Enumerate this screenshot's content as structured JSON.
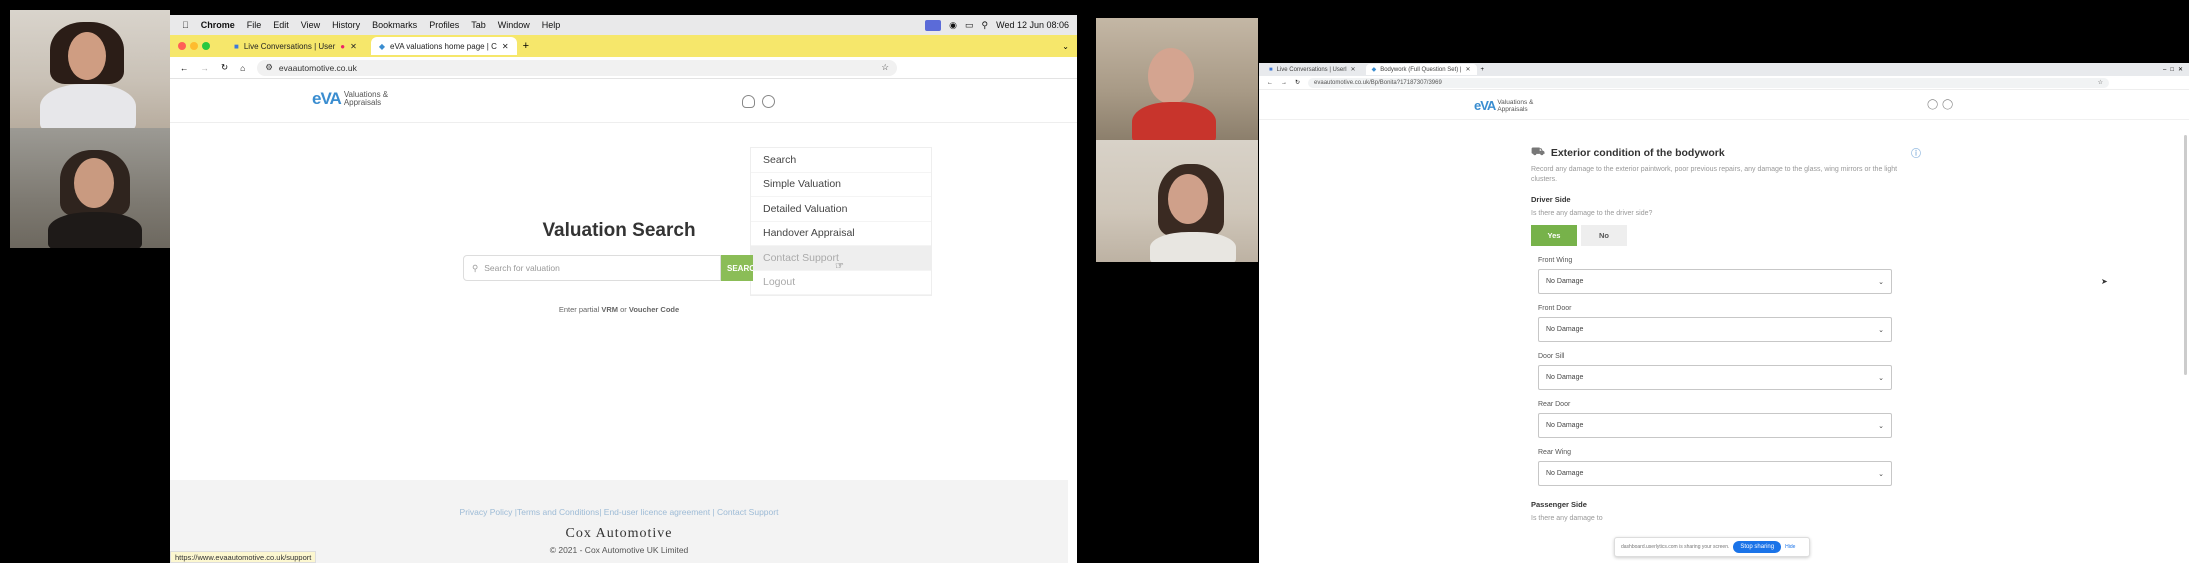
{
  "mac": {
    "menubar": {
      "apple": "",
      "app": "Chrome",
      "items": [
        "File",
        "Edit",
        "View",
        "History",
        "Bookmarks",
        "Profiles",
        "Tab",
        "Window",
        "Help"
      ],
      "clock": "Wed 12 Jun  08:06"
    },
    "tabs": [
      {
        "label": "Live Conversations | User"
      },
      {
        "label": "eVA valuations home page | C"
      }
    ],
    "url": "evaautomotive.co.uk",
    "logo": {
      "eva": "eVA",
      "line1": "Valuations &",
      "line2": "Appraisals"
    },
    "menu": {
      "items": [
        "Search",
        "Simple Valuation",
        "Detailed Valuation",
        "Handover Appraisal",
        "Contact Support",
        "Logout"
      ]
    },
    "title": "Valuation Search",
    "search": {
      "placeholder": "Search for valuation",
      "button": "SEARCH"
    },
    "hint": {
      "prefix": "Enter partial ",
      "vrm": "VRM",
      "or": " or ",
      "voucher": "Voucher Code"
    },
    "footer": {
      "links": "Privacy Policy  |Terms and Conditions| End-user licence agreement  |  Contact Support",
      "brand": "Cox Automotive",
      "copyright": "© 2021 - Cox Automotive UK Limited"
    },
    "status_url": "https://www.evaautomotive.co.uk/support"
  },
  "win": {
    "tabs": [
      {
        "label": "Live Conversations | Userl"
      },
      {
        "label": "Bodywork (Full Question Set) |"
      }
    ],
    "url": "evaautomotive.co.uk/Bp/Bonita?17187307/3969",
    "logo": {
      "eva": "eVA",
      "line1": "Valuations &",
      "line2": "Appraisals"
    },
    "section": {
      "title": "Exterior condition of the bodywork",
      "description": "Record any damage to the exterior paintwork, poor previous repairs, any damage to the glass, wing mirrors or the light clusters."
    },
    "driver": {
      "title": "Driver Side",
      "question": "Is there any damage to the driver side?",
      "yes": "Yes",
      "no": "No"
    },
    "fields": [
      {
        "label": "Front Wing",
        "value": "No Damage"
      },
      {
        "label": "Front Door",
        "value": "No Damage"
      },
      {
        "label": "Door Sill",
        "value": "No Damage"
      },
      {
        "label": "Rear Door",
        "value": "No Damage"
      },
      {
        "label": "Rear Wing",
        "value": "No Damage"
      }
    ],
    "passenger": {
      "title": "Passenger Side",
      "question": "Is there any damage to"
    },
    "share_bar": {
      "text": "dashboard.userlytics.com is sharing your screen.",
      "stop": "Stop sharing",
      "hide": "Hide"
    }
  },
  "colors": {
    "accent_green": "#77b24a",
    "brand_blue": "#3a8dd0",
    "tab_yellow": "#f6e76b"
  }
}
